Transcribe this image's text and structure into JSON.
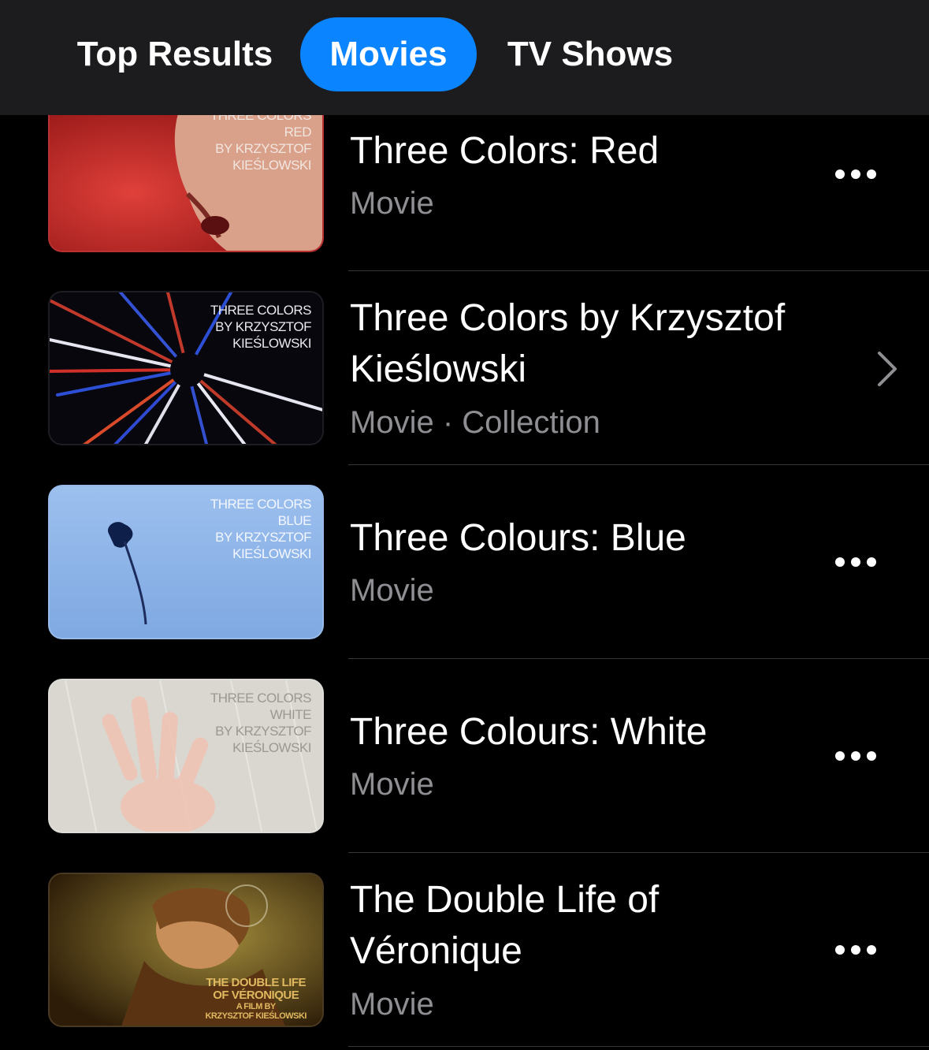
{
  "tabs": [
    {
      "label": "Top Results",
      "selected": false
    },
    {
      "label": "Movies",
      "selected": true
    },
    {
      "label": "TV Shows",
      "selected": false
    }
  ],
  "accent_color": "#0a84ff",
  "results": [
    {
      "title": "Three Colors: Red",
      "subtitle": "Movie",
      "action": "more-icon",
      "poster_text": [
        "THREE COLORS",
        "RED",
        "BY KRZYSZTOF",
        "KIEŚLOWSKI"
      ]
    },
    {
      "title_line1": "Three Colors by Krzysztof",
      "title_line2": "Kieślowski",
      "subtitle": "Movie · Collection",
      "action": "chevron-right-icon",
      "poster_text": [
        "THREE COLORS",
        "BY KRZYSZTOF",
        "KIEŚLOWSKI"
      ]
    },
    {
      "title": "Three Colours: Blue",
      "subtitle": "Movie",
      "action": "more-icon",
      "poster_text": [
        "THREE COLORS",
        "BLUE",
        "BY KRZYSZTOF",
        "KIEŚLOWSKI"
      ]
    },
    {
      "title": "Three Colours: White",
      "subtitle": "Movie",
      "action": "more-icon",
      "poster_text": [
        "THREE COLORS",
        "WHITE",
        "BY KRZYSZTOF",
        "KIEŚLOWSKI"
      ]
    },
    {
      "title_line1": "The Double Life of",
      "title_line2": "Véronique",
      "subtitle": "Movie",
      "action": "more-icon",
      "poster_text": [
        "THE DOUBLE LIFE",
        "OF VÉRONIQUE",
        "A FILM BY",
        "KRZYSZTOF KIEŚLOWSKI"
      ]
    }
  ]
}
